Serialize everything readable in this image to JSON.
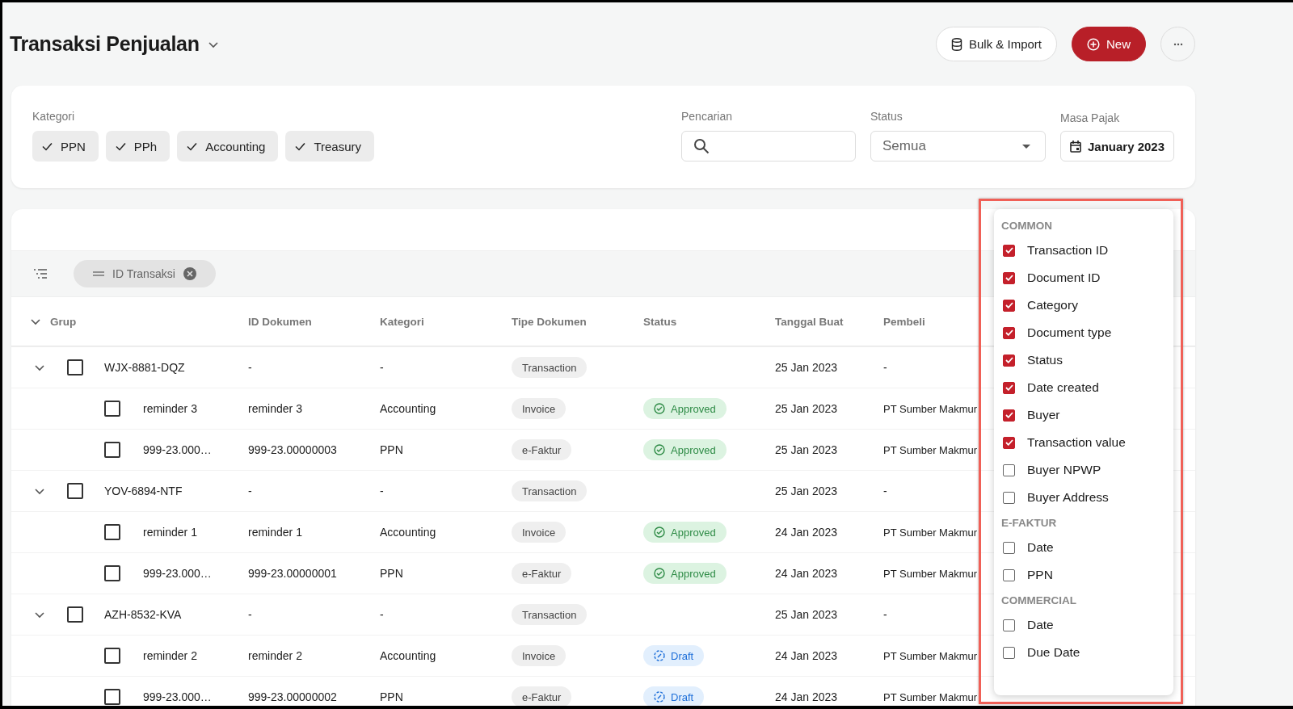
{
  "title": "Transaksi Penjualan",
  "actions": [
    {
      "kind": "outline",
      "label": "Bulk & Import"
    },
    {
      "kind": "primary",
      "label": "New"
    },
    {
      "kind": "more"
    }
  ],
  "filters": {
    "category": {
      "label": "Kategori",
      "chips": [
        {
          "label": "PPN",
          "selected": true
        },
        {
          "label": "PPh",
          "selected": true
        },
        {
          "label": "Accounting",
          "selected": true
        },
        {
          "label": "Treasury",
          "selected": true
        }
      ]
    },
    "search": {
      "label": "Pencarian"
    },
    "status": {
      "label": "Status",
      "value": "Semua"
    },
    "period": {
      "label": "Masa Pajak",
      "value": "January 2023"
    }
  },
  "group_bar": {
    "chips": [
      {
        "label": "ID Transaksi"
      }
    ]
  },
  "table": {
    "columns": [
      "Grup",
      "ID Dokumen",
      "Kategori",
      "Tipe Dokumen",
      "Status",
      "Tanggal Buat",
      "Pembeli"
    ],
    "groups": [
      {
        "id": "WJX-8881-DQZ",
        "expanded": true,
        "checked": false,
        "doc_id": "-",
        "category": "-",
        "doc_type": "Transaction",
        "date": "25 Jan 2023",
        "buyer": "-",
        "children": [
          {
            "name": "reminder 3",
            "checked": false,
            "doc_id": "reminder 3",
            "category": "Accounting",
            "doc_type": "Invoice",
            "status": {
              "kind": "approved",
              "label": "Approved"
            },
            "date": "25 Jan 2023",
            "buyer": "PT Sumber Makmur"
          },
          {
            "name": "999-23.000…",
            "checked": false,
            "doc_id": "999-23.00000003",
            "category": "PPN",
            "doc_type": "e-Faktur",
            "status": {
              "kind": "approved",
              "label": "Approved"
            },
            "date": "25 Jan 2023",
            "buyer": "PT Sumber Makmur"
          }
        ]
      },
      {
        "id": "YOV-6894-NTF",
        "expanded": true,
        "checked": false,
        "doc_id": "-",
        "category": "-",
        "doc_type": "Transaction",
        "date": "25 Jan 2023",
        "buyer": "-",
        "children": [
          {
            "name": "reminder 1",
            "checked": false,
            "doc_id": "reminder 1",
            "category": "Accounting",
            "doc_type": "Invoice",
            "status": {
              "kind": "approved",
              "label": "Approved"
            },
            "date": "24 Jan 2023",
            "buyer": "PT Sumber Makmur"
          },
          {
            "name": "999-23.000…",
            "checked": false,
            "doc_id": "999-23.00000001",
            "category": "PPN",
            "doc_type": "e-Faktur",
            "status": {
              "kind": "approved",
              "label": "Approved"
            },
            "date": "24 Jan 2023",
            "buyer": "PT Sumber Makmur"
          }
        ]
      },
      {
        "id": "AZH-8532-KVA",
        "expanded": true,
        "checked": false,
        "doc_id": "-",
        "category": "-",
        "doc_type": "Transaction",
        "date": "25 Jan 2023",
        "buyer": "-",
        "children": [
          {
            "name": "reminder 2",
            "checked": false,
            "doc_id": "reminder 2",
            "category": "Accounting",
            "doc_type": "Invoice",
            "status": {
              "kind": "draft",
              "label": "Draft"
            },
            "date": "24 Jan 2023",
            "buyer": "PT Sumber Makmur"
          },
          {
            "name": "999-23.000…",
            "checked": false,
            "doc_id": "999-23.00000002",
            "category": "PPN",
            "doc_type": "e-Faktur",
            "status": {
              "kind": "draft",
              "label": "Draft"
            },
            "date": "24 Jan 2023",
            "buyer": "PT Sumber Makmur"
          }
        ]
      }
    ]
  },
  "column_menu": {
    "sections": [
      {
        "title": "COMMON",
        "items": [
          {
            "label": "Transaction ID",
            "checked": true
          },
          {
            "label": "Document ID",
            "checked": true
          },
          {
            "label": "Category",
            "checked": true
          },
          {
            "label": "Document type",
            "checked": true
          },
          {
            "label": "Status",
            "checked": true
          },
          {
            "label": "Date created",
            "checked": true
          },
          {
            "label": "Buyer",
            "checked": true
          },
          {
            "label": "Transaction value",
            "checked": true
          },
          {
            "label": "Buyer NPWP",
            "checked": false
          },
          {
            "label": "Buyer Address",
            "checked": false
          }
        ]
      },
      {
        "title": "E-FAKTUR",
        "items": [
          {
            "label": "Date",
            "checked": false
          },
          {
            "label": "PPN",
            "checked": false
          }
        ]
      },
      {
        "title": "COMMERCIAL",
        "items": [
          {
            "label": "Date",
            "checked": false
          },
          {
            "label": "Due Date",
            "checked": false
          }
        ]
      }
    ]
  }
}
